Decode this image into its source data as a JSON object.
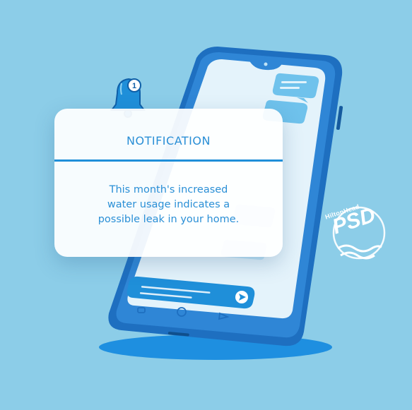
{
  "notification": {
    "title": "NOTIFICATION",
    "message_lines": [
      "This month's increased",
      "water usage indicates a",
      "possible leak in your home."
    ],
    "badge_count": "1"
  },
  "logo": {
    "top": "HiltonHead",
    "main": "PSD"
  },
  "colors": {
    "background": "#8ccde8",
    "phone_body": "#1e6fc0",
    "phone_screen": "#e4f3fb",
    "accent": "#1f8fd9",
    "bubble": "#6fc2ec"
  },
  "icons": {
    "bell": "bell-icon",
    "send": "send-arrow-icon",
    "nav_back": "nav-back-icon",
    "nav_home": "nav-home-icon",
    "nav_recent": "nav-recent-icon"
  }
}
